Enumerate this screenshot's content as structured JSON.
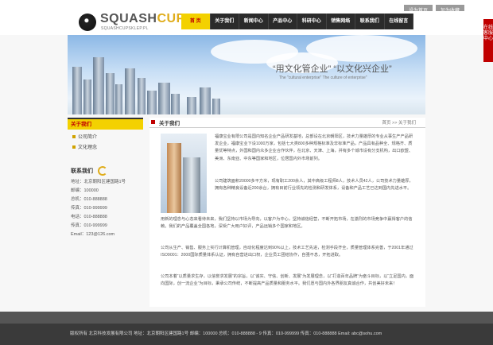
{
  "toplinks": [
    "设为首页",
    "加为收藏"
  ],
  "logo": {
    "name_a": "SQUASH",
    "name_b": "CUP",
    "tagline": "SQUASHCUPSKLEP.PL"
  },
  "nav": [
    "首 页",
    "关于我们",
    "新闻中心",
    "产品中心",
    "科研中心",
    "销售网络",
    "联系我们",
    "在线留言"
  ],
  "banner": {
    "slogan": "“用文化管企业”  “以文化兴企业”",
    "slogan_en": "The \"cultural enterprise\"  The culture of enterprise\""
  },
  "sidebar": {
    "title": "关于我们",
    "items": [
      "公司简介",
      "文化理念"
    ],
    "contact_title": "联系我们",
    "contact": [
      "地址：北京朝阳区建国路1号",
      "邮编：100000",
      "总机：010-888888",
      "传真：010-999999",
      "电话：010-888888",
      "传真：010-999999",
      "Email：123@126.com"
    ]
  },
  "main": {
    "title": "关于我们",
    "breadcrumb": "首页 >> 关于我们",
    "paragraphs": [
      "福康宝业有限公司是国内知名企业产品研发基地，总部设在北京朝阳区，技术力量雄厚的专业从事生产产品研发企业，福康宝业下设1000万家，包括七大类800多种规格标准及非标准产品，产品具有品种全、规格齐、质量优等特点，外国和国内众多企业合作伙伴，在北京、天津、上海，并有多个城市设有分支机构，出口欧盟、美洲、东南亚、中东等国家和地区，位居国内外市场前列。",
      "公司建筑面积20000多平方米，现有职工200余人，其中高级工程师8人，技术人员42人，公司技术力量雄厚，拥有各种精良设备近200余台，拥有目前行业领先的检测和研发体系，设备和产品工艺已达到国内先进水平。",
      "用新的理念与心态来看待未来，我们坚持以市场为导向，以客户为中心，坚持诚信经营，不断开拓市场，在激烈的市场竞争中赢得客户的信赖。我们的产品覆盖全国各地，深受广大用户好评，产品远销多个国家和地区。",
      "公司从生产、销售、服务上实行计算机管理，自动化程度达到90%以上，技术工艺先进，检测手段齐全，质量管理体系完善，于2001年通过ISO9001：2000国际质量体系认证，拥有自营进出口权，企业员工团结协作，自强不息，开拓进取。",
      "公司本着“以质量求生存，以信誉求发展”的宗旨，以“诚实、守信、创新、发展”为发展理念，以“打造百年品牌”为奋斗目标，以“立足国内，面向国际，创一流企业”为目标，秉承公司传统，不断提高产品质量和服务水平。我们愿与国内外各界朋友真诚合作，共创美好未来！"
    ]
  },
  "footer": "版权所有  北京科技发展有限公司  地址：北京朝阳区建国路1号  邮编：100000  总机：010-888888 - 9  传真：010-999999  传真：010-888888  Email: abc@sohu.com",
  "sidetab": "在线客服中心"
}
